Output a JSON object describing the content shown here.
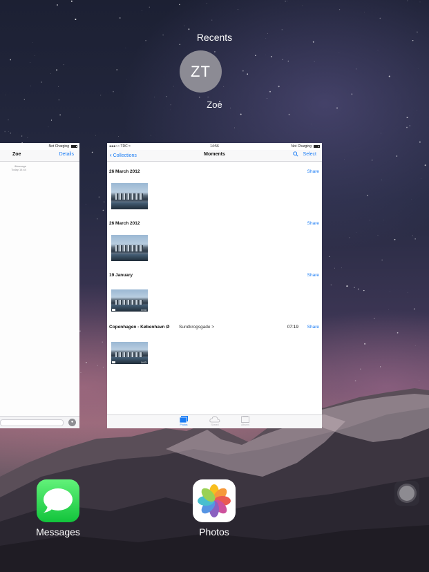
{
  "recents": {
    "title": "Recents",
    "contact_initials": "ZT",
    "contact_name": "Zoe"
  },
  "messages_card": {
    "status_text": "Not Charging",
    "title": "Zoe",
    "details_label": "Details",
    "meta_line1": "iMessage",
    "meta_line2": "Today 14:44",
    "mic_icon": "microphone-icon"
  },
  "photos_card": {
    "status": {
      "carrier": "●●●○○ TDC",
      "wifi_icon": "wifi-icon",
      "time": "14:56",
      "charging": "Not Charging"
    },
    "nav": {
      "back_label": "Collections",
      "title": "Moments",
      "search_icon": "search-icon",
      "select_label": "Select"
    },
    "moments": [
      {
        "date": "26 March 2012",
        "place": "",
        "time": "",
        "share": "Share",
        "video": false,
        "duration": ""
      },
      {
        "date": "26 March 2012",
        "place": "",
        "time": "",
        "share": "Share",
        "video": false,
        "duration": ""
      },
      {
        "date": "19 January",
        "place": "",
        "time": "",
        "share": "Share",
        "video": true,
        "duration": "0:03"
      },
      {
        "date": "Copenhagen - København Ø",
        "place": "Sundkrogsgade >",
        "time": "07:19",
        "share": "Share",
        "video": true,
        "duration": "0:03"
      }
    ],
    "tabs": [
      {
        "label": "Photos",
        "active": true
      },
      {
        "label": "Shared",
        "active": false
      },
      {
        "label": "Albums",
        "active": false
      }
    ]
  },
  "home_apps": [
    {
      "label": "Messages",
      "icon": "messages-app-icon"
    },
    {
      "label": "Photos",
      "icon": "photos-app-icon"
    }
  ],
  "colors": {
    "accent": "#1a7cf5",
    "messages_green": "#12c43c"
  }
}
